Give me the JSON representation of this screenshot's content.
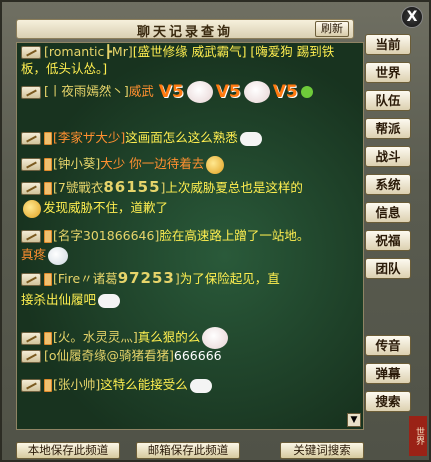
{
  "window": {
    "title": "聊天记录查询",
    "refresh_label": "刷新",
    "close_label": "X"
  },
  "tabs": [
    {
      "label": "当前"
    },
    {
      "label": "世界"
    },
    {
      "label": "队伍"
    },
    {
      "label": "帮派"
    },
    {
      "label": "战斗"
    },
    {
      "label": "系统"
    },
    {
      "label": "信息"
    },
    {
      "label": "祝福"
    },
    {
      "label": "团队"
    }
  ],
  "tabs_lower": [
    {
      "label": "传音"
    },
    {
      "label": "弹幕"
    },
    {
      "label": "搜索"
    }
  ],
  "messages": [
    {
      "name": "[romantic┣Mr]",
      "text": "[盛世修缘 威武霸气] [嗨爱狗 踢到铁板，低头认怂。]"
    },
    {
      "name": "[丨夜雨嫣然丶]",
      "text": "威武",
      "v5": "V5"
    },
    {
      "name": "[李家ザ大少]",
      "text": "这画面怎么这么熟悉"
    },
    {
      "name": "[钟小葵]",
      "text": "大少 你一边待着去"
    },
    {
      "name": "[7號戰衣",
      "num": "86155",
      "name_end": "]",
      "text": "上次威胁夏总也是这样的",
      "text2": "发现威胁不住，道歉了"
    },
    {
      "name": "[名字301866646]",
      "text": "脸在高速路上蹭了一站地。",
      "text2": "真疼"
    },
    {
      "name": "[Fire〃诸葛",
      "num": "97253",
      "name_end": "]",
      "text": "为了保险起见，直",
      "text2": "接杀出仙履吧"
    },
    {
      "name": "[火。水灵灵灬]",
      "text": "真么狠的么"
    },
    {
      "name": "[o仙履奇缘@骑猪看猪]",
      "text": "666666"
    },
    {
      "name": "[张小帅]",
      "text": "这特么能接受么"
    }
  ],
  "bottom": {
    "local_save": "本地保存此频道",
    "mail_save": "邮箱保存此频道",
    "keyword_search": "关键词搜索"
  },
  "seal_text": "世界"
}
